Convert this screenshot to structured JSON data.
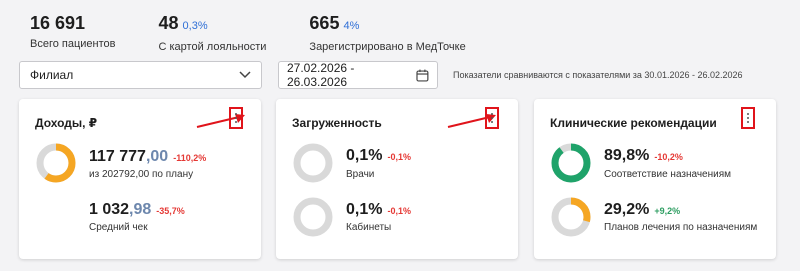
{
  "stats": [
    {
      "value": "16 691",
      "delta": "",
      "label": "Всего пациентов"
    },
    {
      "value": "48",
      "delta": "0,3%",
      "label": "С картой лояльности"
    },
    {
      "value": "665",
      "delta": "4%",
      "label": "Зарегистрировано в МедТочке"
    }
  ],
  "filters": {
    "branch_value": "Филиал",
    "date_range": "27.02.2026 - 26.03.2026",
    "compare_note": "Показатели сравниваются с показателями за 30.01.2026 - 26.02.2026"
  },
  "colors": {
    "orange": "#f5a623",
    "green": "#1fa36a",
    "grey_ring": "#d9d9d9",
    "red": "#e53935",
    "highlight": "#e0141b"
  },
  "cards": [
    {
      "title": "Доходы, ₽",
      "metrics": [
        {
          "value_int": "117 777",
          "value_dec": ",00",
          "delta": "-110,2%",
          "sub": "из 202792,00 по плану",
          "fill_percent": 60,
          "color": "orange"
        },
        {
          "value_int": "1 032",
          "value_dec": ",98",
          "delta": "-35,7%",
          "sub": "Средний чек"
        }
      ]
    },
    {
      "title": "Загруженность",
      "metrics": [
        {
          "value": "0,1%",
          "delta": "-0,1%",
          "sub": "Врачи",
          "fill_percent": 0.1
        },
        {
          "value": "0,1%",
          "delta": "-0,1%",
          "sub": "Кабинеты",
          "fill_percent": 0.1
        }
      ]
    },
    {
      "title": "Клинические рекомендации",
      "metrics": [
        {
          "value": "89,8%",
          "delta": "-10,2%",
          "sub": "Соответствие назначениям",
          "fill_percent": 89.8,
          "color": "green"
        },
        {
          "value": "29,2%",
          "delta": "+9,2%",
          "sub": "Планов лечения по назначениям",
          "fill_percent": 29.2,
          "color": "orange"
        }
      ]
    }
  ]
}
